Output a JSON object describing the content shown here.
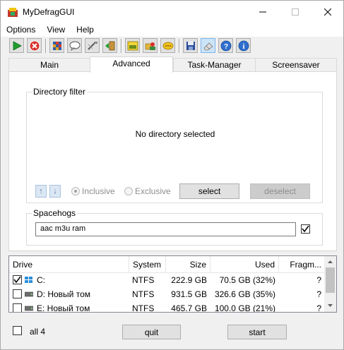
{
  "window": {
    "title": "MyDefragGUI"
  },
  "menu": {
    "items": [
      "Options",
      "View",
      "Help"
    ]
  },
  "toolbar": {
    "icons": [
      "run-icon",
      "stop-icon",
      "grid-icon",
      "speech-bubble-icon",
      "tool-icon",
      "door-exit-icon",
      "mydefrag-logo-icon",
      "folders-icon",
      "chat-icon",
      "save-icon",
      "eraser-icon",
      "help-icon",
      "info-icon"
    ]
  },
  "tabs": [
    "Main",
    "Advanced",
    "Task-Manager",
    "Screensaver"
  ],
  "active_tab": "Advanced",
  "directory_filter": {
    "legend": "Directory filter",
    "status": "No directory selected",
    "up_label": "↑",
    "down_label": "↓",
    "inclusive_label": "Inclusive",
    "exclusive_label": "Exclusive",
    "select_label": "select",
    "deselect_label": "deselect"
  },
  "spacehogs": {
    "legend": "Spacehogs",
    "value": "aac m3u ram",
    "checked": true
  },
  "drive_list": {
    "columns": [
      "Drive",
      "System",
      "Size",
      "Used",
      "Fragm..."
    ],
    "rows": [
      {
        "drive": "C:",
        "system": "NTFS",
        "size": "222.9 GB",
        "used": "70.5 GB (32%)",
        "fragm": "?",
        "checked": true
      },
      {
        "drive": "D: Новый том",
        "system": "NTFS",
        "size": "931.5 GB",
        "used": "326.6 GB (35%)",
        "fragm": "?",
        "checked": false
      },
      {
        "drive": "E: Новый том",
        "system": "NTFS",
        "size": "465.7 GB",
        "used": "100.0 GB (21%)",
        "fragm": "?",
        "checked": false
      }
    ]
  },
  "footer": {
    "all_label": "all 4",
    "quit_label": "quit",
    "start_label": "start"
  },
  "colors": {
    "accent_blue": "#0078d7",
    "run_green": "#1e9e2d",
    "stop_red": "#d9302b"
  }
}
